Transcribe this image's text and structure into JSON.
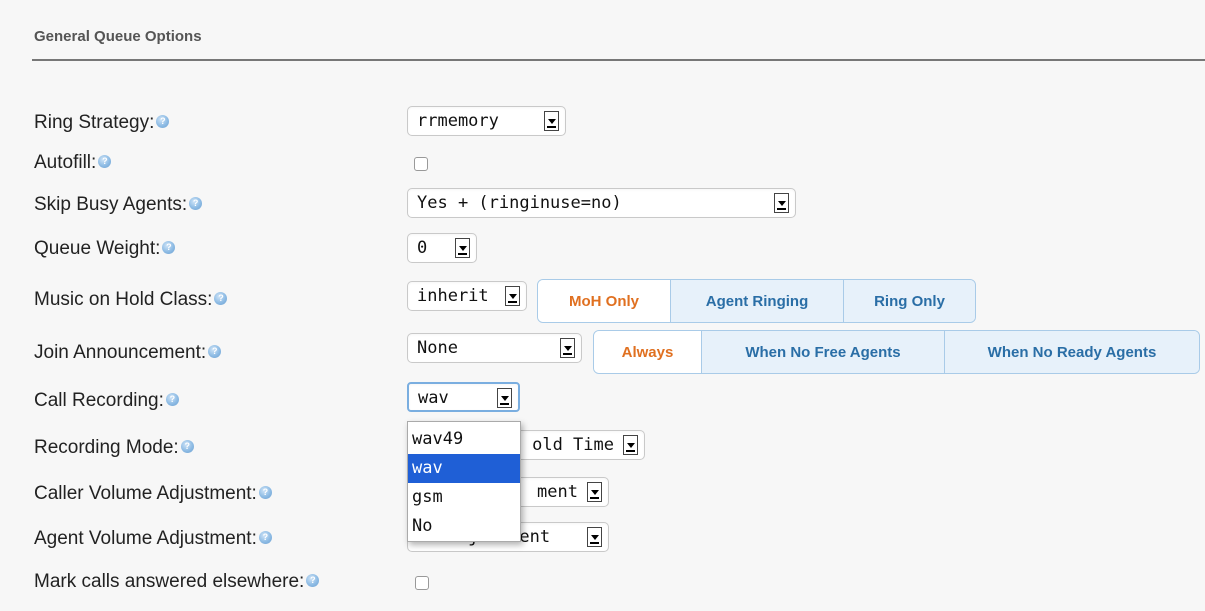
{
  "section": {
    "title": "General Queue Options"
  },
  "fields": {
    "ring_strategy": {
      "label": "Ring Strategy:",
      "value": "rrmemory"
    },
    "autofill": {
      "label": "Autofill:",
      "checked": false
    },
    "skip_busy_agents": {
      "label": "Skip Busy Agents:",
      "value": "Yes + (ringinuse=no)"
    },
    "queue_weight": {
      "label": "Queue Weight:",
      "value": "0"
    },
    "music_on_hold": {
      "label": "Music on Hold Class:",
      "value": "inherit",
      "buttons": [
        "MoH Only",
        "Agent Ringing",
        "Ring Only"
      ],
      "active": "MoH Only"
    },
    "join_announcement": {
      "label": "Join Announcement:",
      "value": "None",
      "buttons": [
        "Always",
        "When No Free Agents",
        "When No Ready Agents"
      ],
      "active": "Always"
    },
    "call_recording": {
      "label": "Call Recording:",
      "value": "wav",
      "options": [
        "wav49",
        "wav",
        "gsm",
        "No"
      ],
      "selected": "wav"
    },
    "recording_mode": {
      "label": "Recording Mode:",
      "value_visible": "old Time"
    },
    "caller_volume": {
      "label": "Caller Volume Adjustment:",
      "value_visible": "ment"
    },
    "agent_volume": {
      "label": "Agent Volume Adjustment:",
      "value_visible": "No Adjustment"
    },
    "mark_answered": {
      "label": "Mark calls answered elsewhere:",
      "checked": false
    }
  },
  "icons": {
    "help": "help-icon",
    "dropdown": "dropdown-arrow-icon"
  },
  "colors": {
    "active_button_text": "#e07020",
    "button_text": "#2a6ea6",
    "selection": "#1f5fd6"
  }
}
